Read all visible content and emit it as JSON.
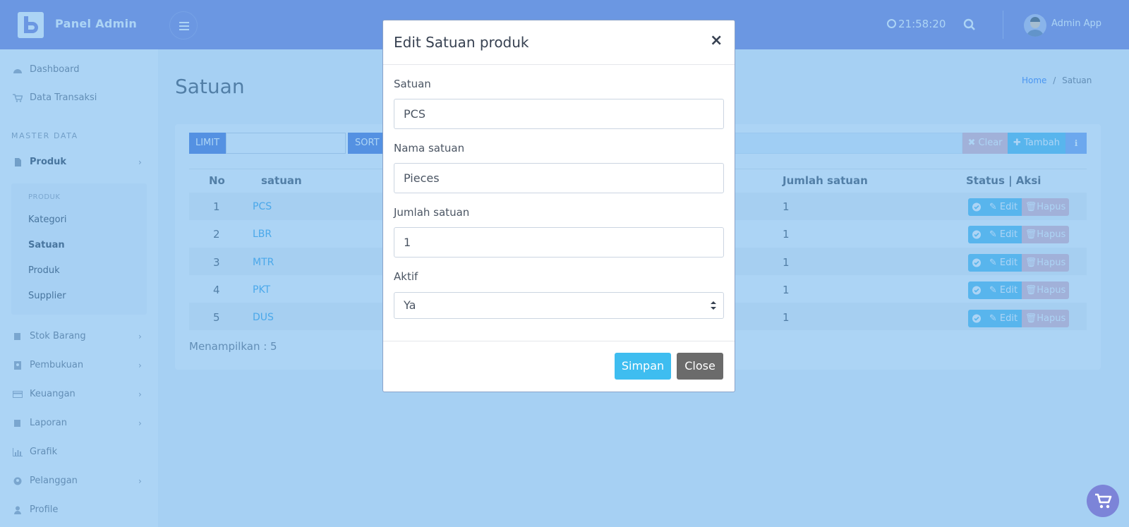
{
  "topbar": {
    "brand": "Panel Admin",
    "clock": "21:58:20",
    "user": "Admin App",
    "color": "#7c84d8"
  },
  "sidebar": {
    "items_top": [
      {
        "label": "Dashboard",
        "icon": "dashboard-icon"
      },
      {
        "label": "Data Transaksi",
        "icon": "cart-icon"
      }
    ],
    "section_label": "MASTER DATA",
    "produk": {
      "label": "Produk",
      "icon": "file-icon"
    },
    "submenu": {
      "heading": "PRODUK",
      "items": [
        "Kategori",
        "Satuan",
        "Produk",
        "Supplier"
      ]
    },
    "items_bottom": [
      {
        "label": "Stok Barang",
        "icon": "book-icon",
        "has_children": true
      },
      {
        "label": "Pembukuan",
        "icon": "contact-icon",
        "has_children": true
      },
      {
        "label": "Keuangan",
        "icon": "card-icon",
        "has_children": true
      },
      {
        "label": "Laporan",
        "icon": "book-icon",
        "has_children": true
      },
      {
        "label": "Grafik",
        "icon": "chart-icon",
        "has_children": false
      },
      {
        "label": "Pelanggan",
        "icon": "user-circle-icon",
        "has_children": true
      },
      {
        "label": "Profile",
        "icon": "user-icon",
        "has_children": false
      }
    ]
  },
  "page": {
    "title": "Satuan",
    "breadcrumb": {
      "home": "Home",
      "separator": "/",
      "current": "Satuan"
    }
  },
  "toolbar": {
    "limit_label": "LIMIT",
    "sort_label": "SORT",
    "clear_label": "Clear",
    "add_label": "Tambah"
  },
  "table": {
    "headers": {
      "no": "No",
      "satuan": "satuan",
      "jumlah": "Jumlah satuan",
      "aksi": "Status | Aksi"
    },
    "rows": [
      {
        "no": "1",
        "satuan": "PCS",
        "jumlah": "1"
      },
      {
        "no": "2",
        "satuan": "LBR",
        "jumlah": "1"
      },
      {
        "no": "3",
        "satuan": "MTR",
        "jumlah": "1"
      },
      {
        "no": "4",
        "satuan": "PKT",
        "jumlah": "1"
      },
      {
        "no": "5",
        "satuan": "DUS",
        "jumlah": "1"
      }
    ],
    "edit_label": "Edit",
    "delete_label": "Hapus",
    "footer": "Menampilkan : 5"
  },
  "modal": {
    "title": "Edit Satuan produk",
    "close_glyph": "×",
    "fields": {
      "satuan": {
        "label": "Satuan",
        "value": "PCS"
      },
      "nama": {
        "label": "Nama satuan",
        "value": "Pieces"
      },
      "jumlah": {
        "label": "Jumlah satuan",
        "value": "1"
      },
      "aktif": {
        "label": "Aktif",
        "value": "Ya"
      }
    },
    "save_label": "Simpan",
    "close_label": "Close"
  }
}
